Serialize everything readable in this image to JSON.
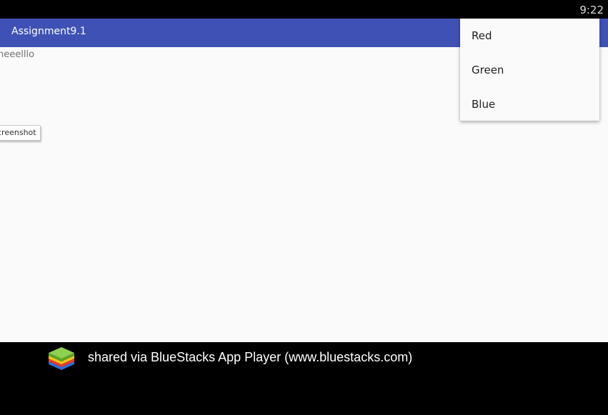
{
  "status_bar": {
    "time": "9:22"
  },
  "app_bar": {
    "title": "Assignment9.1"
  },
  "content": {
    "hello_text": "heeelllo",
    "screenshot_button_label": "creenshot"
  },
  "popup_menu": {
    "items": [
      {
        "label": "Red"
      },
      {
        "label": "Green"
      },
      {
        "label": "Blue"
      }
    ]
  },
  "footer": {
    "logo_icon": "bluestacks-logo-icon",
    "text": "shared via BlueStacks App Player (www.bluestacks.com)"
  },
  "colors": {
    "app_bar": "#3f51b5",
    "content_background": "#fafafa",
    "status_bar": "#000000",
    "footer": "#000000"
  }
}
